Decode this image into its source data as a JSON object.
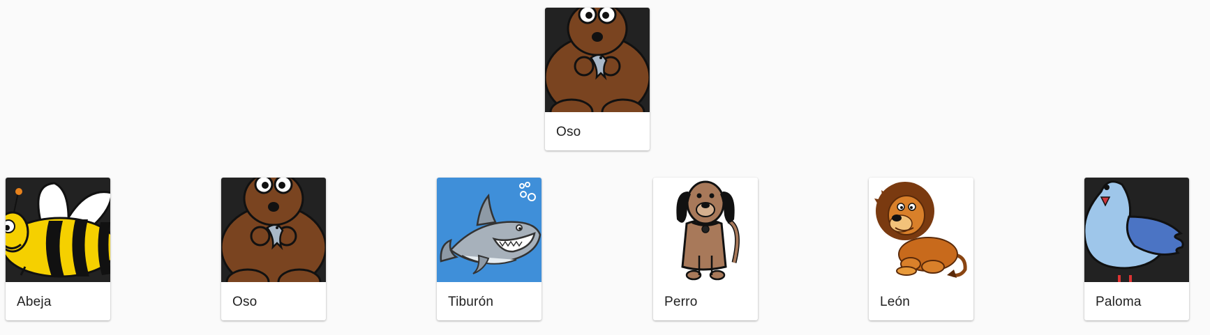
{
  "featured": {
    "label": "Oso",
    "icon": "bear-icon"
  },
  "cards": [
    {
      "label": "Abeja",
      "icon": "bee-icon"
    },
    {
      "label": "Oso",
      "icon": "bear-icon"
    },
    {
      "label": "Tiburón",
      "icon": "shark-icon"
    },
    {
      "label": "Perro",
      "icon": "dog-icon"
    },
    {
      "label": "León",
      "icon": "lion-icon"
    },
    {
      "label": "Paloma",
      "icon": "pigeon-icon"
    }
  ],
  "colors": {
    "background": "#fafafa",
    "card": "#ffffff",
    "dark_tile": "#222222",
    "ocean_tile": "#3f8fd9",
    "text": "#212121"
  }
}
